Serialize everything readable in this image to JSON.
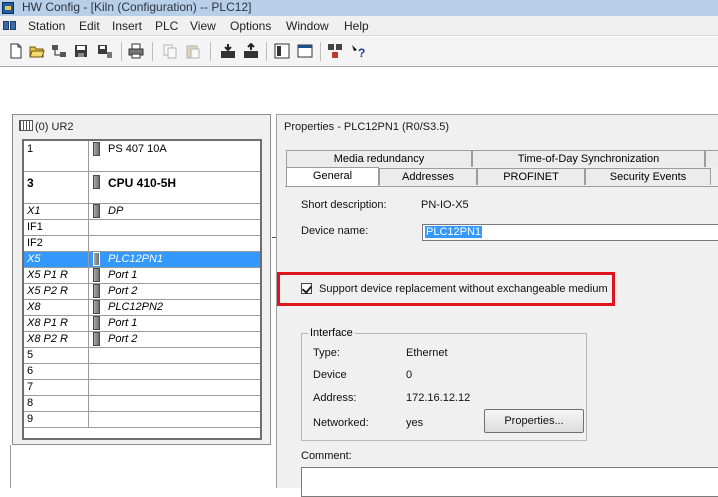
{
  "window": {
    "title": "HW Config - [Kiln (Configuration) -- PLC12]"
  },
  "menu": [
    "Station",
    "Edit",
    "Insert",
    "PLC",
    "View",
    "Options",
    "Window",
    "Help"
  ],
  "toolbar": {
    "icons": [
      "new-icon",
      "open-icon",
      "network-icon",
      "save-icon",
      "save-compile-icon",
      "print-icon",
      "copy-icon",
      "paste-icon",
      "download-icon",
      "upload-icon",
      "catalog-icon",
      "window-icon",
      "nettpro-icon",
      "help-icon"
    ]
  },
  "rack": {
    "title": "(0) UR2",
    "slots": [
      {
        "slot": "1",
        "module": "PS 407 10A"
      },
      {
        "slot": "3",
        "module": "CPU 410-5H"
      },
      {
        "slot": "X1",
        "module": "DP"
      },
      {
        "slot": "IF1",
        "module": ""
      },
      {
        "slot": "IF2",
        "module": ""
      },
      {
        "slot": "X5",
        "module": "PLC12PN1"
      },
      {
        "slot": "X5 P1 R",
        "module": "Port 1"
      },
      {
        "slot": "X5 P2 R",
        "module": "Port 2"
      },
      {
        "slot": "X8",
        "module": "PLC12PN2"
      },
      {
        "slot": "X8 P1 R",
        "module": "Port 1"
      },
      {
        "slot": "X8 P2 R",
        "module": "Port 2"
      },
      {
        "slot": "5",
        "module": ""
      },
      {
        "slot": "6",
        "module": ""
      },
      {
        "slot": "7",
        "module": ""
      },
      {
        "slot": "8",
        "module": ""
      },
      {
        "slot": "9",
        "module": ""
      }
    ]
  },
  "dialog": {
    "title": "Properties - PLC12PN1 (R0/S3.5)",
    "tabs_row1": [
      "Media redundancy",
      "Time-of-Day Synchronization"
    ],
    "tabs_row2": [
      "General",
      "Addresses",
      "PROFINET",
      "Security Events"
    ],
    "active_tab": "General",
    "short_description_label": "Short description:",
    "short_description_value": "PN-IO-X5",
    "device_name_label": "Device name:",
    "device_name_value": "PLC12PN1",
    "support_replacement_label": "Support device replacement without exchangeable medium",
    "support_replacement_checked": true,
    "interface": {
      "legend": "Interface",
      "type_label": "Type:",
      "type_value": "Ethernet",
      "device_label": "Device",
      "device_value": "0",
      "address_label": "Address:",
      "address_value": "172.16.12.12",
      "networked_label": "Networked:",
      "networked_value": "yes",
      "properties_button": "Properties..."
    },
    "comment_label": "Comment:",
    "comment_value": ""
  },
  "colors": {
    "highlight": "#e0141c",
    "selection": "#3399ff"
  }
}
